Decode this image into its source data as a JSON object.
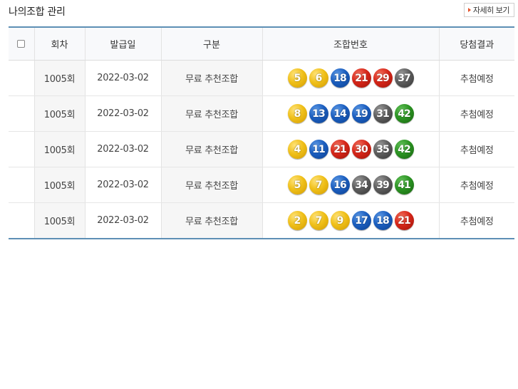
{
  "header": {
    "title": "나의조합 관리",
    "more_label": "자세히 보기"
  },
  "columns": [
    "회차",
    "발급일",
    "구분",
    "조합번호",
    "당첨결과"
  ],
  "colors": {
    "yellow": "#f0c01a",
    "blue": "#1c5fc0",
    "red": "#d7271a",
    "gray": "#5e5e5e",
    "green": "#2c9423",
    "table_border": "#5d8fb5"
  },
  "rows": [
    {
      "round": "1005회",
      "date": "2022-03-02",
      "type": "무료 추천조합",
      "numbers": [
        5,
        6,
        18,
        21,
        29,
        37
      ],
      "result": "추첨예정"
    },
    {
      "round": "1005회",
      "date": "2022-03-02",
      "type": "무료 추천조합",
      "numbers": [
        8,
        13,
        14,
        19,
        31,
        42
      ],
      "result": "추첨예정"
    },
    {
      "round": "1005회",
      "date": "2022-03-02",
      "type": "무료 추천조합",
      "numbers": [
        4,
        11,
        21,
        30,
        35,
        42
      ],
      "result": "추첨예정"
    },
    {
      "round": "1005회",
      "date": "2022-03-02",
      "type": "무료 추천조합",
      "numbers": [
        5,
        7,
        16,
        34,
        39,
        41
      ],
      "result": "추첨예정"
    },
    {
      "round": "1005회",
      "date": "2022-03-02",
      "type": "무료 추천조합",
      "numbers": [
        2,
        7,
        9,
        17,
        18,
        21
      ],
      "result": "추첨예정"
    }
  ]
}
